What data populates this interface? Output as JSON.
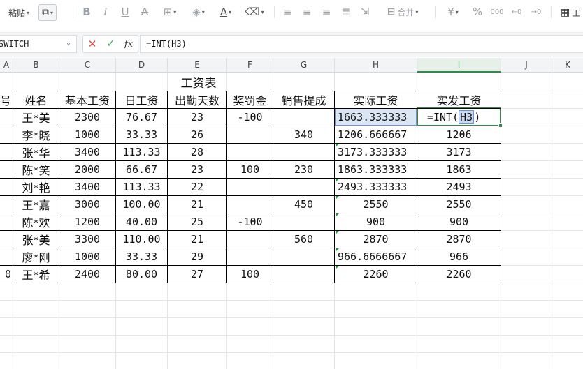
{
  "toolbar": {
    "paste_label": "粘贴",
    "merge_label": "合并",
    "table_label": "工",
    "percent_symbol": "%",
    "currency_symbol": "¥"
  },
  "formula_bar": {
    "name_box": "SWITCH",
    "formula": "=INT(H3)"
  },
  "columns": [
    "A",
    "B",
    "C",
    "D",
    "E",
    "F",
    "G",
    "H",
    "I",
    "J",
    "K"
  ],
  "active_column": "I",
  "sheet": {
    "title": "工资表",
    "headers": {
      "no": "号",
      "name": "姓名",
      "base": "基本工资",
      "daily": "日工资",
      "days": "出勤天数",
      "bonus": "奖罚金",
      "sales": "销售提成",
      "actual": "实际工资",
      "paid": "实发工资"
    },
    "rows": [
      {
        "no": "",
        "name": "王*美",
        "base": "2300",
        "daily": "76.67",
        "days": "23",
        "bonus": "-100",
        "sales": "",
        "actual": "1663.333333",
        "paid": "=INT(",
        "paid_ref": "H3",
        "paid_tail": ")"
      },
      {
        "no": "",
        "name": "李*晓",
        "base": "1000",
        "daily": "33.33",
        "days": "26",
        "bonus": "",
        "sales": "340",
        "actual": "1206.666667",
        "paid": "1206"
      },
      {
        "no": "",
        "name": "张*华",
        "base": "3400",
        "daily": "113.33",
        "days": "28",
        "bonus": "",
        "sales": "",
        "actual": "3173.333333",
        "paid": "3173"
      },
      {
        "no": "",
        "name": "陈*笑",
        "base": "2000",
        "daily": "66.67",
        "days": "23",
        "bonus": "100",
        "sales": "230",
        "actual": "1863.333333",
        "paid": "1863"
      },
      {
        "no": "",
        "name": "刘*艳",
        "base": "3400",
        "daily": "113.33",
        "days": "22",
        "bonus": "",
        "sales": "",
        "actual": "2493.333333",
        "paid": "2493"
      },
      {
        "no": "",
        "name": "王*嘉",
        "base": "3000",
        "daily": "100.00",
        "days": "21",
        "bonus": "",
        "sales": "450",
        "actual": "2550",
        "paid": "2550"
      },
      {
        "no": "",
        "name": "陈*欢",
        "base": "1200",
        "daily": "40.00",
        "days": "25",
        "bonus": "-100",
        "sales": "",
        "actual": "900",
        "paid": "900"
      },
      {
        "no": "",
        "name": "张*美",
        "base": "3300",
        "daily": "110.00",
        "days": "21",
        "bonus": "",
        "sales": "560",
        "actual": "2870",
        "paid": "2870"
      },
      {
        "no": "",
        "name": "廖*刚",
        "base": "1000",
        "daily": "33.33",
        "days": "29",
        "bonus": "",
        "sales": "",
        "actual": "966.6666667",
        "paid": "966"
      },
      {
        "no": "0",
        "name": "王*希",
        "base": "2400",
        "daily": "80.00",
        "days": "27",
        "bonus": "100",
        "sales": "",
        "actual": "2260",
        "paid": "2260"
      }
    ]
  }
}
